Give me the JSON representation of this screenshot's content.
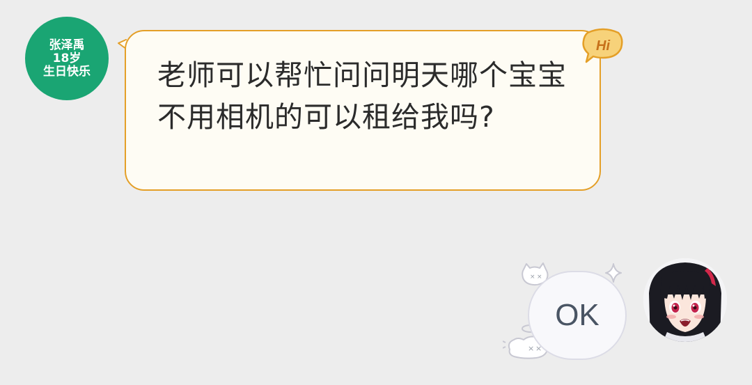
{
  "chat": {
    "sender_avatar": {
      "line1": "张泽禹",
      "line2": "18岁",
      "line3": "生日快乐",
      "bg_color": "#1aa573"
    },
    "incoming_message": {
      "text": "老师可以帮忙问问明天哪个宝宝不用相机的可以租给我吗?",
      "bubble_color": "#fefcf4",
      "border_color": "#e49f27"
    },
    "hi_badge": {
      "text": "Hi",
      "icon": "hi-badge-icon"
    },
    "outgoing_message": {
      "text": "OK",
      "icon": "ok-sticker-bubble"
    },
    "receiver_avatar": {
      "icon": "anime-girl-avatar"
    }
  }
}
